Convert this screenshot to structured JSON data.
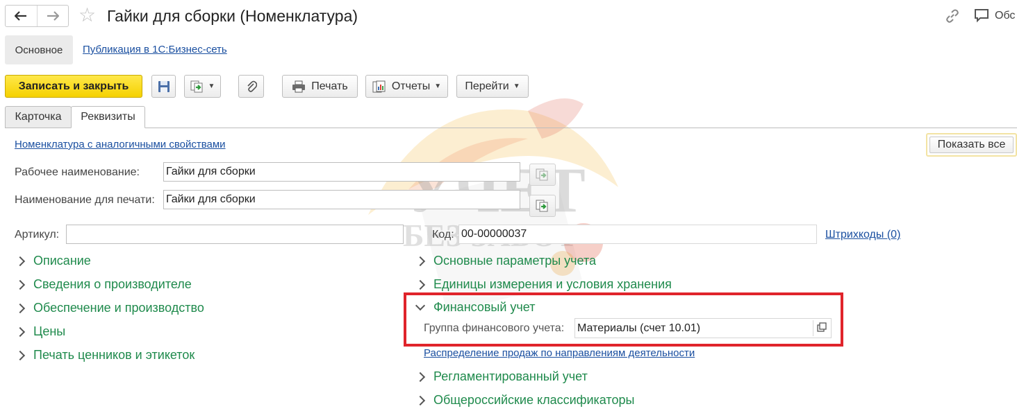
{
  "window": {
    "title": "Гайки для сборки (Номенклатура)",
    "comment_label": "Обс",
    "nav_back_icon": "arrow-left-icon",
    "nav_forward_icon": "arrow-right-icon"
  },
  "sections": {
    "main": "Основное",
    "publication": "Публикация в 1С:Бизнес-сеть"
  },
  "toolbar": {
    "save_close": "Записать и закрыть",
    "print": "Печать",
    "reports": "Отчеты",
    "goto": "Перейти"
  },
  "tabs": {
    "card": "Карточка",
    "requisites": "Реквизиты"
  },
  "form": {
    "analog_link": "Номенклатура с аналогичными свойствами",
    "show_all": "Показать все",
    "work_name_label": "Рабочее наименование:",
    "work_name_value": "Гайки для сборки",
    "print_name_label": "Наименование для печати:",
    "print_name_value": "Гайки для сборки",
    "article_label": "Артикул:",
    "article_value": "",
    "code_label": "Код:",
    "code_value": "00-00000037",
    "barcodes_link": "Штрихкоды (0)"
  },
  "groups_left": [
    "Описание",
    "Сведения о производителе",
    "Обеспечение и производство",
    "Цены",
    "Печать ценников и этикеток"
  ],
  "groups_right": {
    "main_params": "Основные параметры учета",
    "units": "Единицы измерения и условия хранения",
    "financial": "Финансовый учет",
    "fin_group_label": "Группа финансового учета:",
    "fin_group_value": "Материалы (счет 10.01)",
    "sales_distribution_link": "Распределение продаж по направлениям деятельности",
    "regulated": "Регламентированный учет",
    "classifiers": "Общероссийские классификаторы"
  },
  "watermark": {
    "line1": "УЧЕТ",
    "line2": "БЕЗ ЗАБОТ"
  },
  "colors": {
    "accent_yellow": "#f5d100",
    "group_green": "#1f8a4c",
    "link_blue": "#1a4fa0",
    "highlight_red": "#e0242b"
  }
}
